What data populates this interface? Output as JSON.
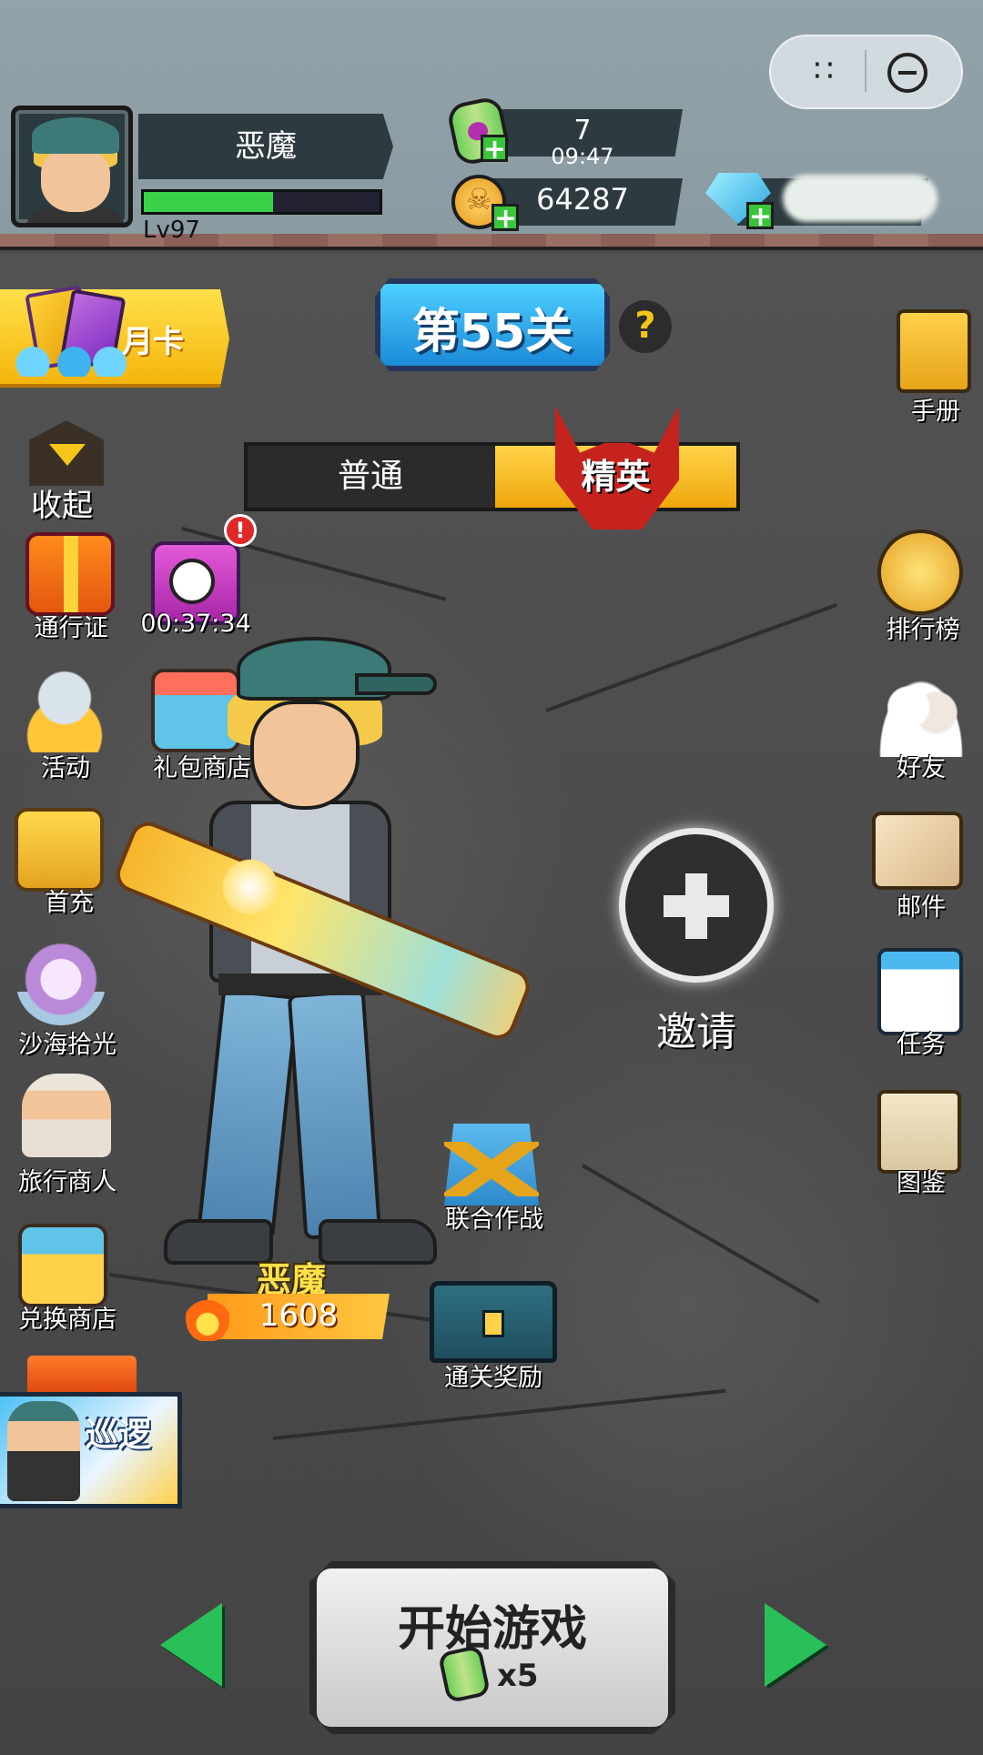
{
  "capsule": {
    "dots": "∷"
  },
  "player": {
    "name": "恶魔",
    "level": "Lv97",
    "xp_fraction": 0.55
  },
  "resources": {
    "energy_count": "7",
    "energy_timer": "09:47",
    "coins": "64287"
  },
  "left_top": {
    "month_card": "月卡"
  },
  "stage": {
    "level_title": "第55关",
    "help": "?",
    "tabs": [
      "普通",
      "精英"
    ],
    "selected_tab": "精英"
  },
  "left_menu": {
    "collapse": "收起",
    "items": [
      {
        "label": "通行证"
      },
      {
        "label": "00:37:34",
        "alert": "!"
      },
      {
        "label": "活动"
      },
      {
        "label": "礼包商店"
      },
      {
        "label": "首充"
      },
      {
        "label": "沙海拾光"
      },
      {
        "label": "旅行商人"
      },
      {
        "label": "兑换商店"
      }
    ],
    "patrol": "巡逻"
  },
  "right_menu": {
    "items": [
      {
        "label": "手册"
      },
      {
        "label": "排行榜"
      },
      {
        "label": "好友"
      },
      {
        "label": "邮件"
      },
      {
        "label": "任务"
      },
      {
        "label": "图鉴"
      }
    ]
  },
  "center": {
    "char_name": "恶魔",
    "power": "1608",
    "invite": "邀请",
    "coop": "联合作战",
    "clear_reward": "通关奖励"
  },
  "bottom": {
    "start": "开始游戏",
    "cost": "x5"
  },
  "colors": {
    "accent_yellow": "#f5b50c",
    "accent_blue": "#1b8ad8",
    "accent_green": "#29c05a",
    "elite_red": "#c6231f"
  }
}
